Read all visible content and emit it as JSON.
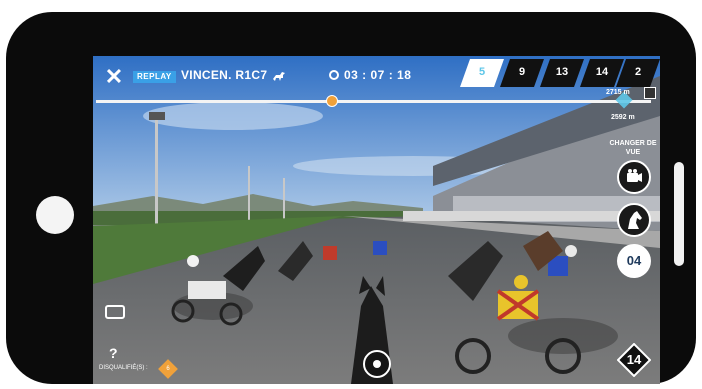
{
  "hud": {
    "close_icon": "close-icon",
    "replay_label": "REPLAY",
    "race_name": "VINCEN. R1C7",
    "timer": "03 : 07 : 18",
    "positions": [
      "5",
      "9",
      "13",
      "14",
      "2"
    ],
    "active_position": "5"
  },
  "progress": {
    "distance_remaining": "2715 m",
    "distance_total": "2592 m"
  },
  "controls": {
    "change_view_label": "CHANGER DE VUE",
    "selected_horse_number": "04",
    "disqualified_label": "DISQUALIFIÉ(S) :",
    "disqualified_badge": "6",
    "focus_horse": "14",
    "help_label": "?"
  },
  "colors": {
    "replay_badge": "#3aa0e6",
    "progress_marker": "#f0a13a",
    "selected_badge": "#ffffff"
  }
}
